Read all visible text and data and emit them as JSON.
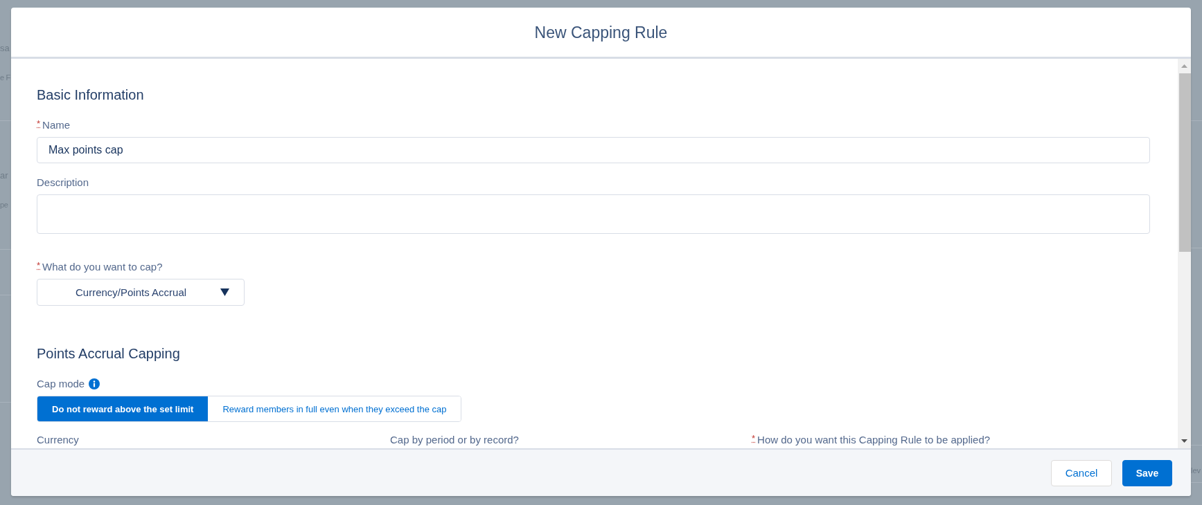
{
  "background_page": {
    "left_rows": [
      {
        "lines": [
          "sa",
          "e F"
        ]
      },
      {
        "lines": [
          "ar",
          "pe"
        ]
      }
    ],
    "right_rows": [
      {
        "lines": [
          "lev"
        ]
      }
    ]
  },
  "modal": {
    "title": "New Capping Rule"
  },
  "sections": [
    {
      "heading": "Basic Information",
      "fields": [
        {
          "kind": "text",
          "label": "Name",
          "required_mark": "*",
          "value": "Max points cap"
        },
        {
          "kind": "textarea",
          "label": "Description"
        },
        {
          "kind": "select",
          "label": "What do you want to cap?",
          "required_mark": "*",
          "value": "Currency/Points Accrual"
        }
      ]
    },
    {
      "heading": "Points Accrual Capping",
      "fields": [
        {
          "kind": "segmented",
          "label": "Cap mode",
          "info": true,
          "options": [
            {
              "label": "Do not reward above the set limit",
              "selected": true
            },
            {
              "label": "Reward members in full even when they exceed the cap",
              "selected": false
            }
          ]
        }
      ],
      "row_labels": [
        {
          "label": "Currency"
        },
        {
          "label": "Cap by period or by record?"
        },
        {
          "label": "How do you want this Capping Rule to be applied?",
          "required_mark": "*"
        }
      ]
    }
  ],
  "footer": {
    "buttons": [
      {
        "kind": "neutral",
        "label": "Cancel"
      },
      {
        "kind": "brand",
        "label": "Save"
      }
    ]
  }
}
